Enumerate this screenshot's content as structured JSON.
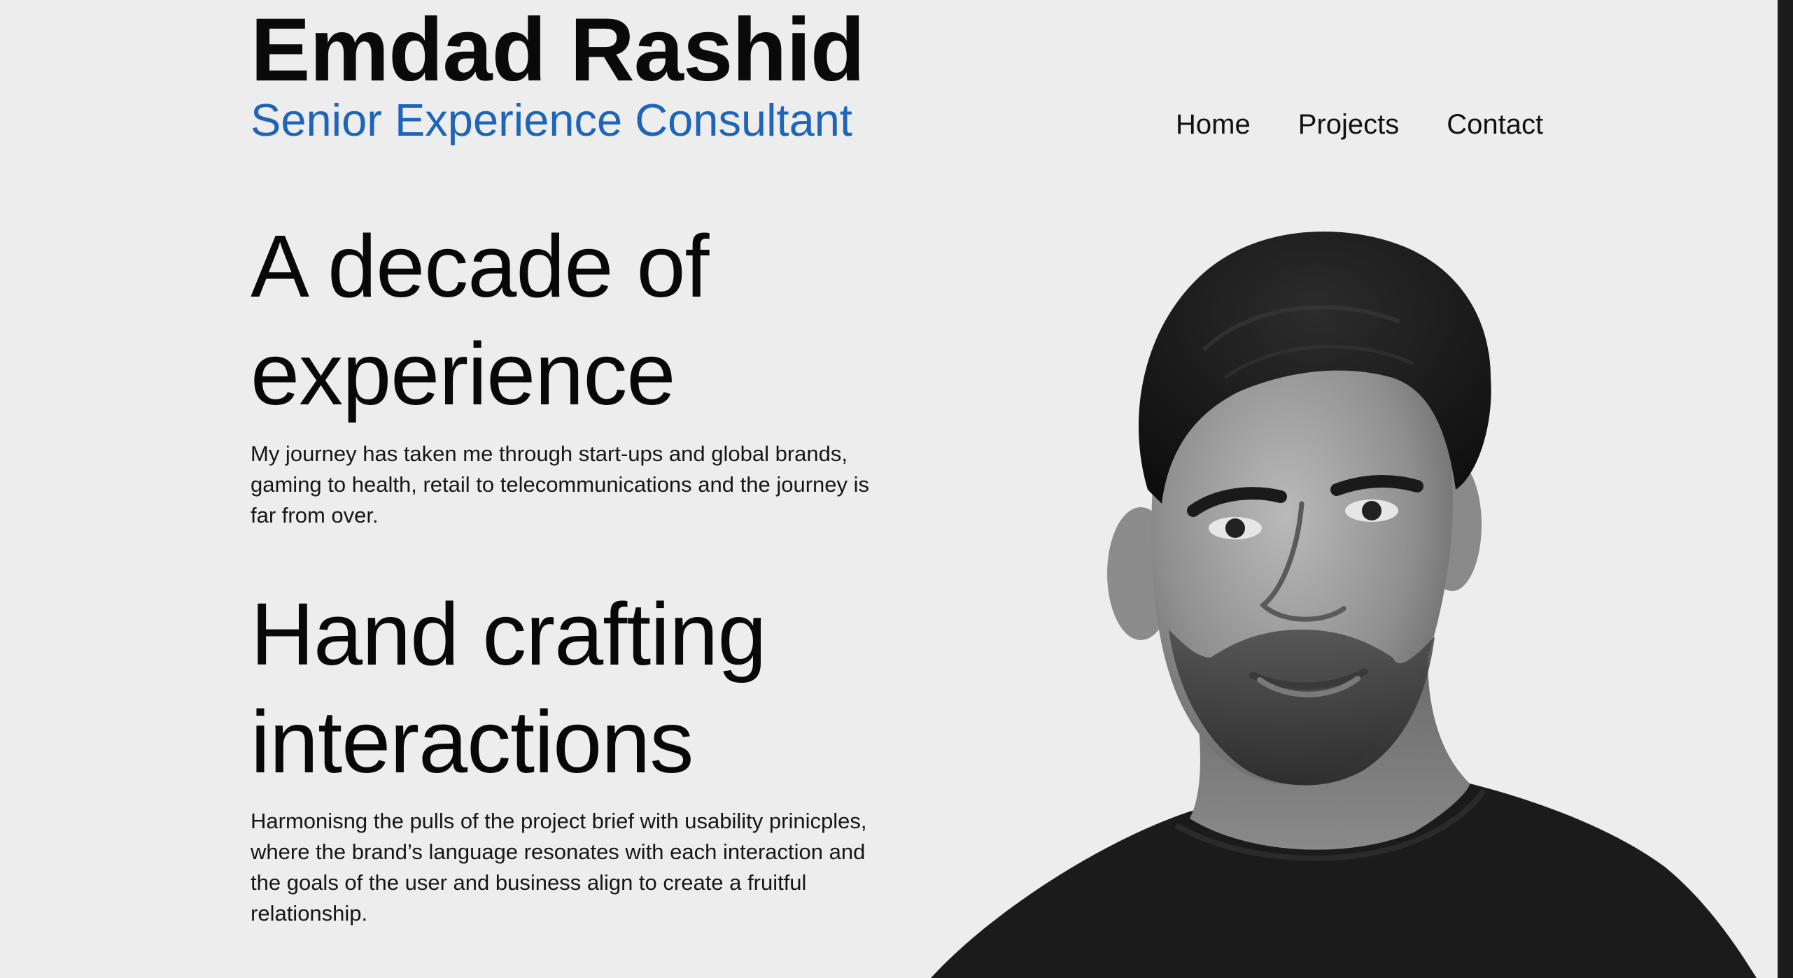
{
  "header": {
    "name": "Emdad Rashid",
    "role": "Senior Experience Consultant"
  },
  "nav": {
    "items": [
      {
        "label": "Home"
      },
      {
        "label": "Projects"
      },
      {
        "label": "Contact"
      }
    ]
  },
  "sections": [
    {
      "title_line1": "A decade of",
      "title_line2": "experience",
      "body_line1": "My journey has taken me through start-ups and global brands,",
      "body_line2": "gaming to health, retail to telecommunications and the journey is",
      "body_line3": "far from over."
    },
    {
      "title_line1": "Hand crafting",
      "title_line2": "interactions",
      "body_line1": "Harmonisng the pulls of the project brief with usability prinicples,",
      "body_line2": "where the brand’s language resonates with each interaction and",
      "body_line3": "the goals of the user and business align to create a fruitful",
      "body_line4": "relationship."
    }
  ],
  "colors": {
    "background": "#ededed",
    "accent": "#1e64b8",
    "text": "#0a0a0a"
  }
}
